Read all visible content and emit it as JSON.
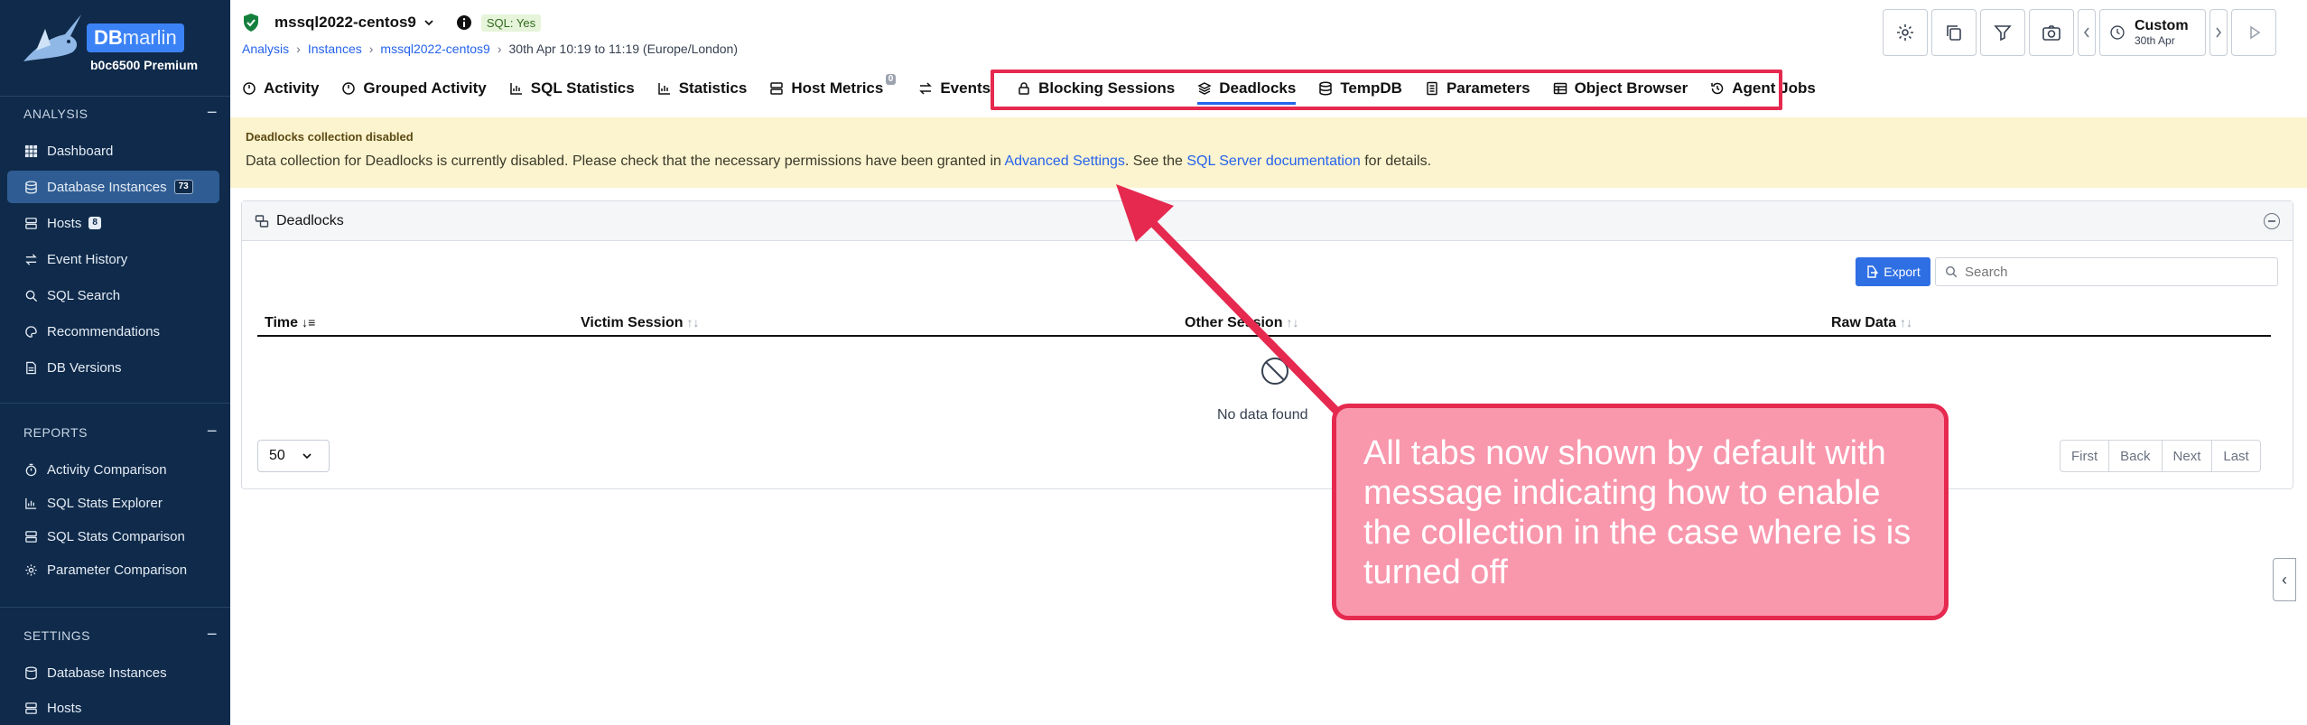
{
  "brand": {
    "db": "DB",
    "marlin": "marlin",
    "plan": "b0c6500 Premium"
  },
  "sidebar": {
    "analysis_label": "ANALYSIS",
    "analysis_items": [
      {
        "label": "Dashboard"
      },
      {
        "label": "Database Instances",
        "count": "73"
      },
      {
        "label": "Hosts",
        "count": "8"
      },
      {
        "label": "Event History"
      },
      {
        "label": "SQL Search"
      },
      {
        "label": "Recommendations"
      },
      {
        "label": "DB Versions"
      }
    ],
    "reports_label": "REPORTS",
    "reports_items": [
      {
        "label": "Activity Comparison"
      },
      {
        "label": "SQL Stats Explorer"
      },
      {
        "label": "SQL Stats Comparison"
      },
      {
        "label": "Parameter Comparison"
      }
    ],
    "settings_label": "SETTINGS",
    "settings_items": [
      {
        "label": "Database Instances"
      },
      {
        "label": "Hosts"
      }
    ]
  },
  "header": {
    "instance": "mssql2022-centos9",
    "sql_badge": "SQL: Yes",
    "breadcrumb": [
      "Analysis",
      "Instances",
      "mssql2022-centos9",
      "30th Apr 10:19 to 11:19 (Europe/London)"
    ],
    "time_label": "Custom",
    "time_sub": "30th Apr"
  },
  "tabs": [
    {
      "label": "Activity"
    },
    {
      "label": "Grouped Activity"
    },
    {
      "label": "SQL Statistics"
    },
    {
      "label": "Statistics"
    },
    {
      "label": "Host Metrics",
      "badge": "0"
    },
    {
      "label": "Events"
    },
    {
      "label": "Blocking Sessions"
    },
    {
      "label": "Deadlocks",
      "active": true
    },
    {
      "label": "TempDB"
    },
    {
      "label": "Parameters"
    },
    {
      "label": "Object Browser"
    },
    {
      "label": "Agent Jobs"
    }
  ],
  "banner": {
    "title": "Deadlocks collection disabled",
    "msg_before": "Data collection for Deadlocks is currently disabled. Please check that the necessary permissions have been granted in ",
    "link1": "Advanced Settings",
    "msg_mid": ". See the ",
    "link2": "SQL Server documentation",
    "msg_after": " for details."
  },
  "panel": {
    "title": "Deadlocks",
    "export_label": "Export",
    "search_placeholder": "Search",
    "columns": [
      "Time",
      "Victim Session",
      "Other Session",
      "Raw Data"
    ],
    "empty_text": "No data found",
    "page_size": "50",
    "pager": [
      "First",
      "Back",
      "Next",
      "Last"
    ]
  },
  "annotation": {
    "text": "All tabs now shown by default with message indicating how to enable the collection in the case where is is turned off",
    "color": "#e5294f"
  }
}
